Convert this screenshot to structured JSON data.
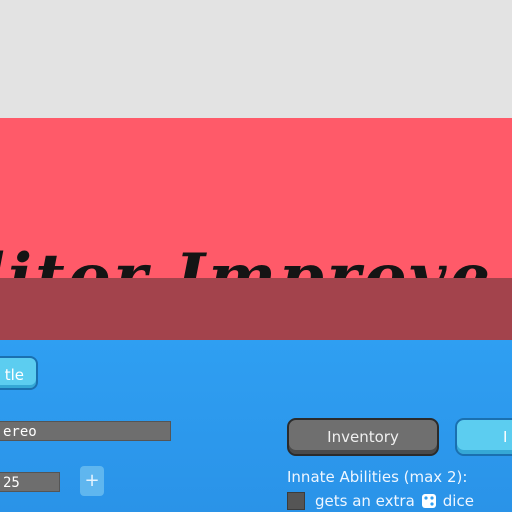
{
  "header": {
    "title": "ditor Improve"
  },
  "toolbar": {
    "title_button_label": "tle"
  },
  "fields": {
    "name_value": "ereo",
    "number_value": "25",
    "plus_label": "+"
  },
  "tabs": {
    "inventory_label": "Inventory",
    "second_label": "I"
  },
  "abilities": {
    "label": "Innate Abilities (max 2):",
    "item_prefix": "gets an extra",
    "item_suffix": "dice"
  },
  "colors": {
    "banner": "#ff5a69",
    "panel": "#2f9ff2",
    "accent_button": "#5ccdf0",
    "gray_button": "#6f6f6f"
  }
}
